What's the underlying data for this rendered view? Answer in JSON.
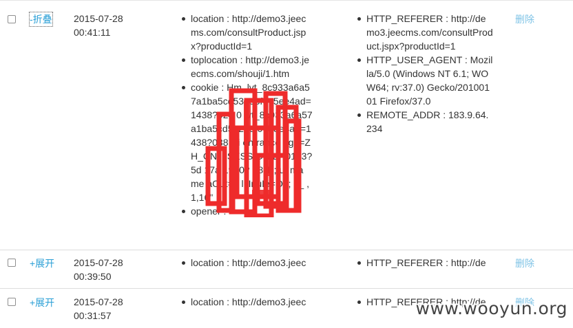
{
  "rows": [
    {
      "toggle": "-折叠",
      "time": "2015-07-28 00:41:11",
      "params1": [
        {
          "text": "location : http://demo3.jeecms.com/consultProduct.jspx?productId=1"
        },
        {
          "text": "toplocation : http://demo3.jeecms.com/shouji/1.htm"
        },
        {
          "text": "cookie : Hm_lvt_8c933a6a57a1ba5cd53253f075ee4ad=1438?024 0 lvt_8c933a6a57a1ba5cd53253f075ee4ad=1438?038 Hi entrance age=ZH_CN; JSESSIONID=0123? 5d 17a 1950? 08 1 ; ut ma me aOut=2 ll InuIe=Og; s_ ,1,16\""
        },
        {
          "text": "opener :"
        }
      ],
      "params2": [
        {
          "text": "HTTP_REFERER : http://demo3.jeecms.com/consultProduct.jspx?productId=1"
        },
        {
          "text": "HTTP_USER_AGENT : Mozilla/5.0 (Windows NT 6.1; WOW64; rv:37.0) Gecko/20100101 Firefox/37.0"
        },
        {
          "text": "REMOTE_ADDR : 183.9.64.234"
        }
      ],
      "delete": "删除"
    },
    {
      "toggle": "+展开",
      "time": "2015-07-28 00:39:50",
      "params1": [
        {
          "text": "location : http://demo3.jeec"
        }
      ],
      "params2": [
        {
          "text": "HTTP_REFERER : http://de"
        }
      ],
      "delete": "删除"
    },
    {
      "toggle": "+展开",
      "time": "2015-07-28 00:31:57",
      "params1": [
        {
          "text": "location : http://demo3.jeec"
        }
      ],
      "params2": [
        {
          "text": "HTTP_REFERER : http://de"
        }
      ],
      "delete": "删除"
    }
  ],
  "watermark": "www.wooyun.org",
  "colors": {
    "link": "#2a9fd6",
    "delete": "#7fc3e6",
    "redaction": "#ee2b2b"
  }
}
